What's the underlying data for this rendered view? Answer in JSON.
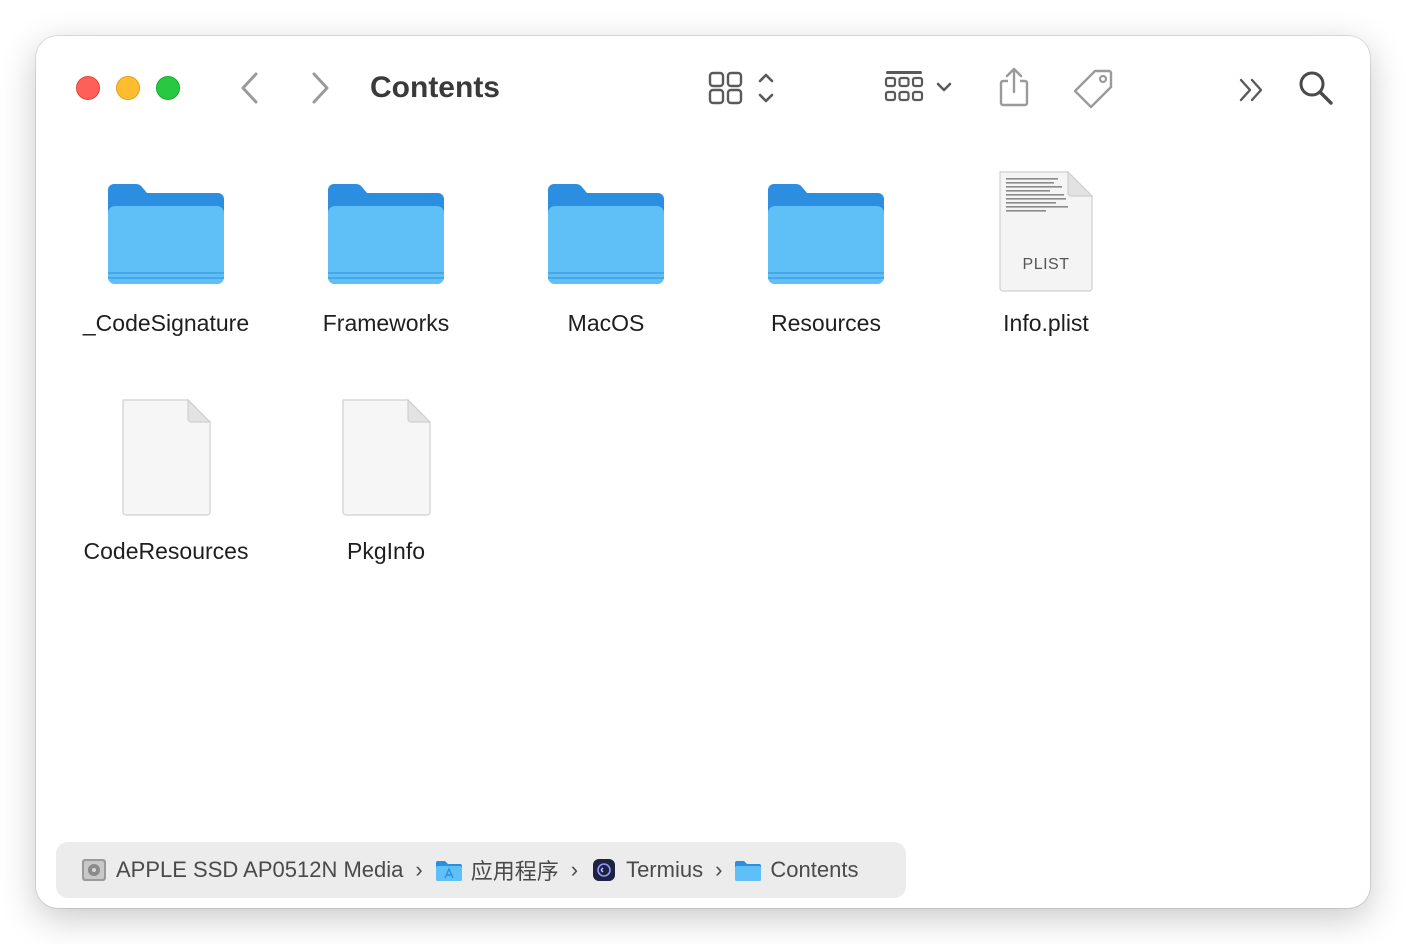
{
  "window": {
    "title": "Contents"
  },
  "toolbar": {
    "back_icon": "chevron-left-icon",
    "forward_icon": "chevron-right-icon",
    "view_icon": "icon-grid-view-icon",
    "group_icon": "group-by-icon",
    "share_icon": "share-icon",
    "tag_icon": "tag-icon",
    "more_icon": "double-chevron-icon",
    "search_icon": "search-icon"
  },
  "items": [
    {
      "name": "_CodeSignature",
      "kind": "folder"
    },
    {
      "name": "Frameworks",
      "kind": "folder"
    },
    {
      "name": "MacOS",
      "kind": "folder"
    },
    {
      "name": "Resources",
      "kind": "folder"
    },
    {
      "name": "Info.plist",
      "kind": "plist",
      "tag": "PLIST"
    },
    {
      "name": "CodeResources",
      "kind": "file"
    },
    {
      "name": "PkgInfo",
      "kind": "file"
    }
  ],
  "path": [
    {
      "label": "APPLE SSD AP0512N Media",
      "icon": "disk-icon"
    },
    {
      "label": "应用程序",
      "icon": "applications-folder-icon"
    },
    {
      "label": "Termius",
      "icon": "termius-app-icon"
    },
    {
      "label": "Contents",
      "icon": "folder-icon"
    }
  ],
  "path_separator": "›",
  "colors": {
    "folder_front": "#5fbff7",
    "folder_back": "#2b8ee0",
    "close": "#ff5f57",
    "minimize": "#febc2e",
    "zoom": "#28c840"
  }
}
